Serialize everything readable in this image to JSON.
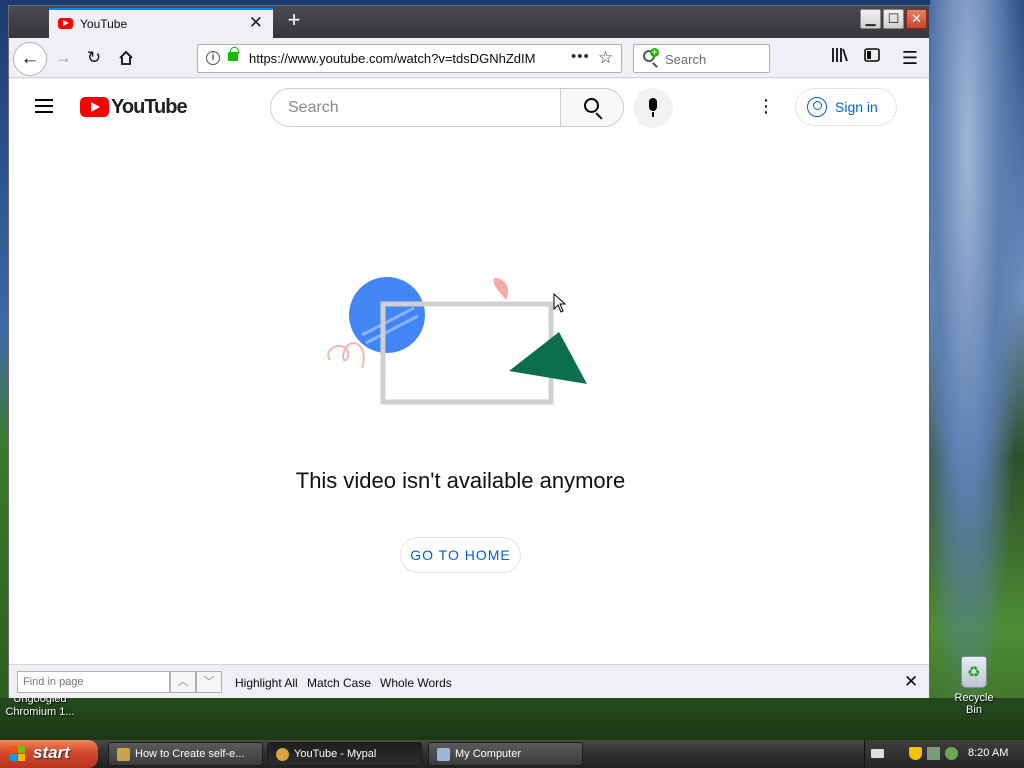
{
  "browser": {
    "tab_title": "YouTube",
    "tab_close": "✕",
    "new_tab": "+",
    "url": "https://www.youtube.com/watch?v=tdsDGNhZdIM",
    "search_placeholder": "Search",
    "page_actions": "•••",
    "bookmark_star": "☆",
    "window_controls": {
      "minimize": "▁",
      "maximize": "☐",
      "close": "✕"
    }
  },
  "youtube": {
    "logo_text": "YouTube",
    "search_placeholder": "Search",
    "sign_in": "Sign in",
    "message": "This video isn't available anymore",
    "home_button": "GO TO HOME"
  },
  "findbar": {
    "placeholder": "Find in page",
    "highlight_all": "Highlight All",
    "match_case": "Match Case",
    "whole_words": "Whole Words",
    "close": "✕"
  },
  "desktop": {
    "left_icon_label_line1": "Ungoogled",
    "left_icon_label_line2": "Chromium 1...",
    "recycle_bin": "Recycle Bin"
  },
  "taskbar": {
    "start": "start",
    "tasks": [
      {
        "label": "How to Create self-e..."
      },
      {
        "label": "YouTube - Mypal"
      },
      {
        "label": "My Computer"
      }
    ],
    "clock": "8:20 AM"
  },
  "colors": {
    "youtube_red": "#ff0000",
    "link_blue": "#065fd4",
    "firefox_accent": "#0a84ff"
  }
}
